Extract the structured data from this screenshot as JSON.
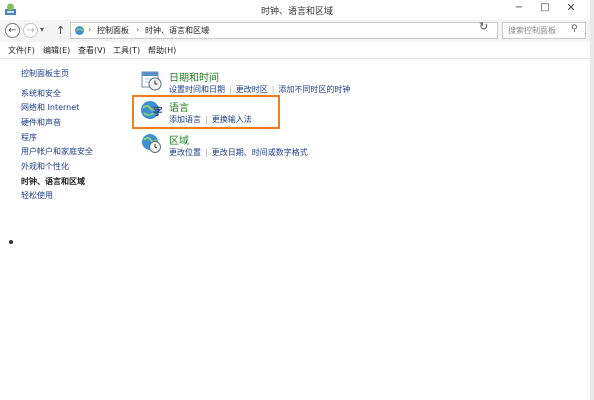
{
  "window": {
    "title": "时钟、语言和区域",
    "minimize": "−",
    "maximize": "□",
    "close": "✕"
  },
  "nav": {
    "back": "←",
    "forward": "→",
    "dropdown": "▾",
    "up": "↑"
  },
  "address": {
    "separator": "›",
    "breadcrumbs": [
      "控制面板",
      "时钟、语言和区域"
    ],
    "dropdown": "▾",
    "refresh": "↻"
  },
  "search": {
    "placeholder": "搜索控制面板",
    "icon": "⚲"
  },
  "menu": [
    "文件(F)",
    "编辑(E)",
    "查看(V)",
    "工具(T)",
    "帮助(H)"
  ],
  "sidebar": {
    "home": "控制面板主页",
    "items": [
      "系统和安全",
      "网络和 Internet",
      "硬件和声音",
      "程序",
      "用户帐户和家庭安全",
      "外观和个性化",
      "时钟、语言和区域",
      "轻松使用"
    ],
    "current_index": 6
  },
  "categories": [
    {
      "title": "日期和时间",
      "icon": "calendar-clock-icon",
      "links": [
        "设置时间和日期",
        "更改时区",
        "添加不同时区的时钟"
      ]
    },
    {
      "title": "语言",
      "icon": "language-globe-icon",
      "links": [
        "添加语言",
        "更换输入法"
      ]
    },
    {
      "title": "区域",
      "icon": "region-globe-clock-icon",
      "links": [
        "更改位置",
        "更改日期、时间或数字格式"
      ]
    }
  ],
  "colors": {
    "category_title": "#1e7d22",
    "link": "#1a3e8c",
    "highlight": "#ef7d22"
  }
}
